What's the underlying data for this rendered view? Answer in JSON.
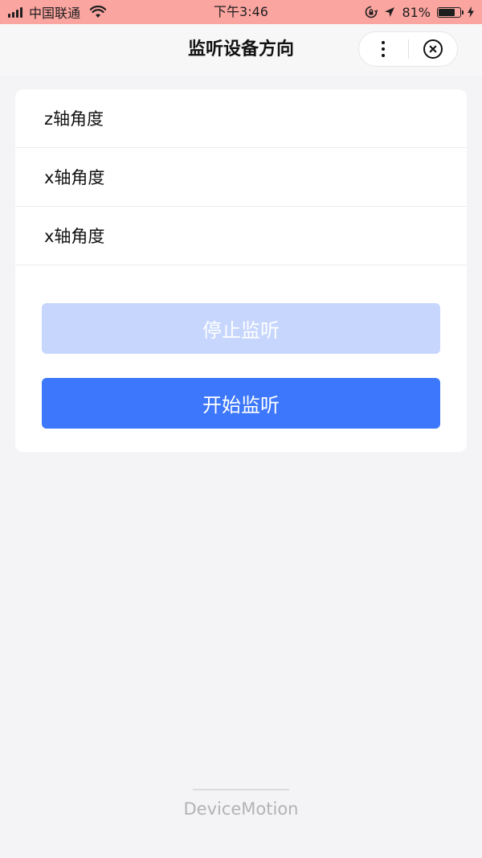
{
  "status_bar": {
    "carrier": "中国联通",
    "time": "下午3:46",
    "battery_percent_label": "81%",
    "battery_level": 0.81
  },
  "nav": {
    "title": "监听设备方向"
  },
  "card": {
    "rows": [
      {
        "label": "z轴角度"
      },
      {
        "label": "x轴角度"
      },
      {
        "label": "x轴角度"
      }
    ],
    "stop_button_label": "停止监听",
    "start_button_label": "开始监听"
  },
  "footer": {
    "text": "DeviceMotion"
  },
  "colors": {
    "status_bar_bg": "#fba5a0",
    "primary_button": "#3d77fb",
    "disabled_button": "#c6d6fd",
    "page_bg": "#f4f3f6"
  },
  "icons": [
    "signal-icon",
    "wifi-icon",
    "rotation-lock-icon",
    "location-arrow-icon",
    "battery-icon",
    "charging-bolt-icon",
    "more-dots-icon",
    "close-circle-icon"
  ]
}
